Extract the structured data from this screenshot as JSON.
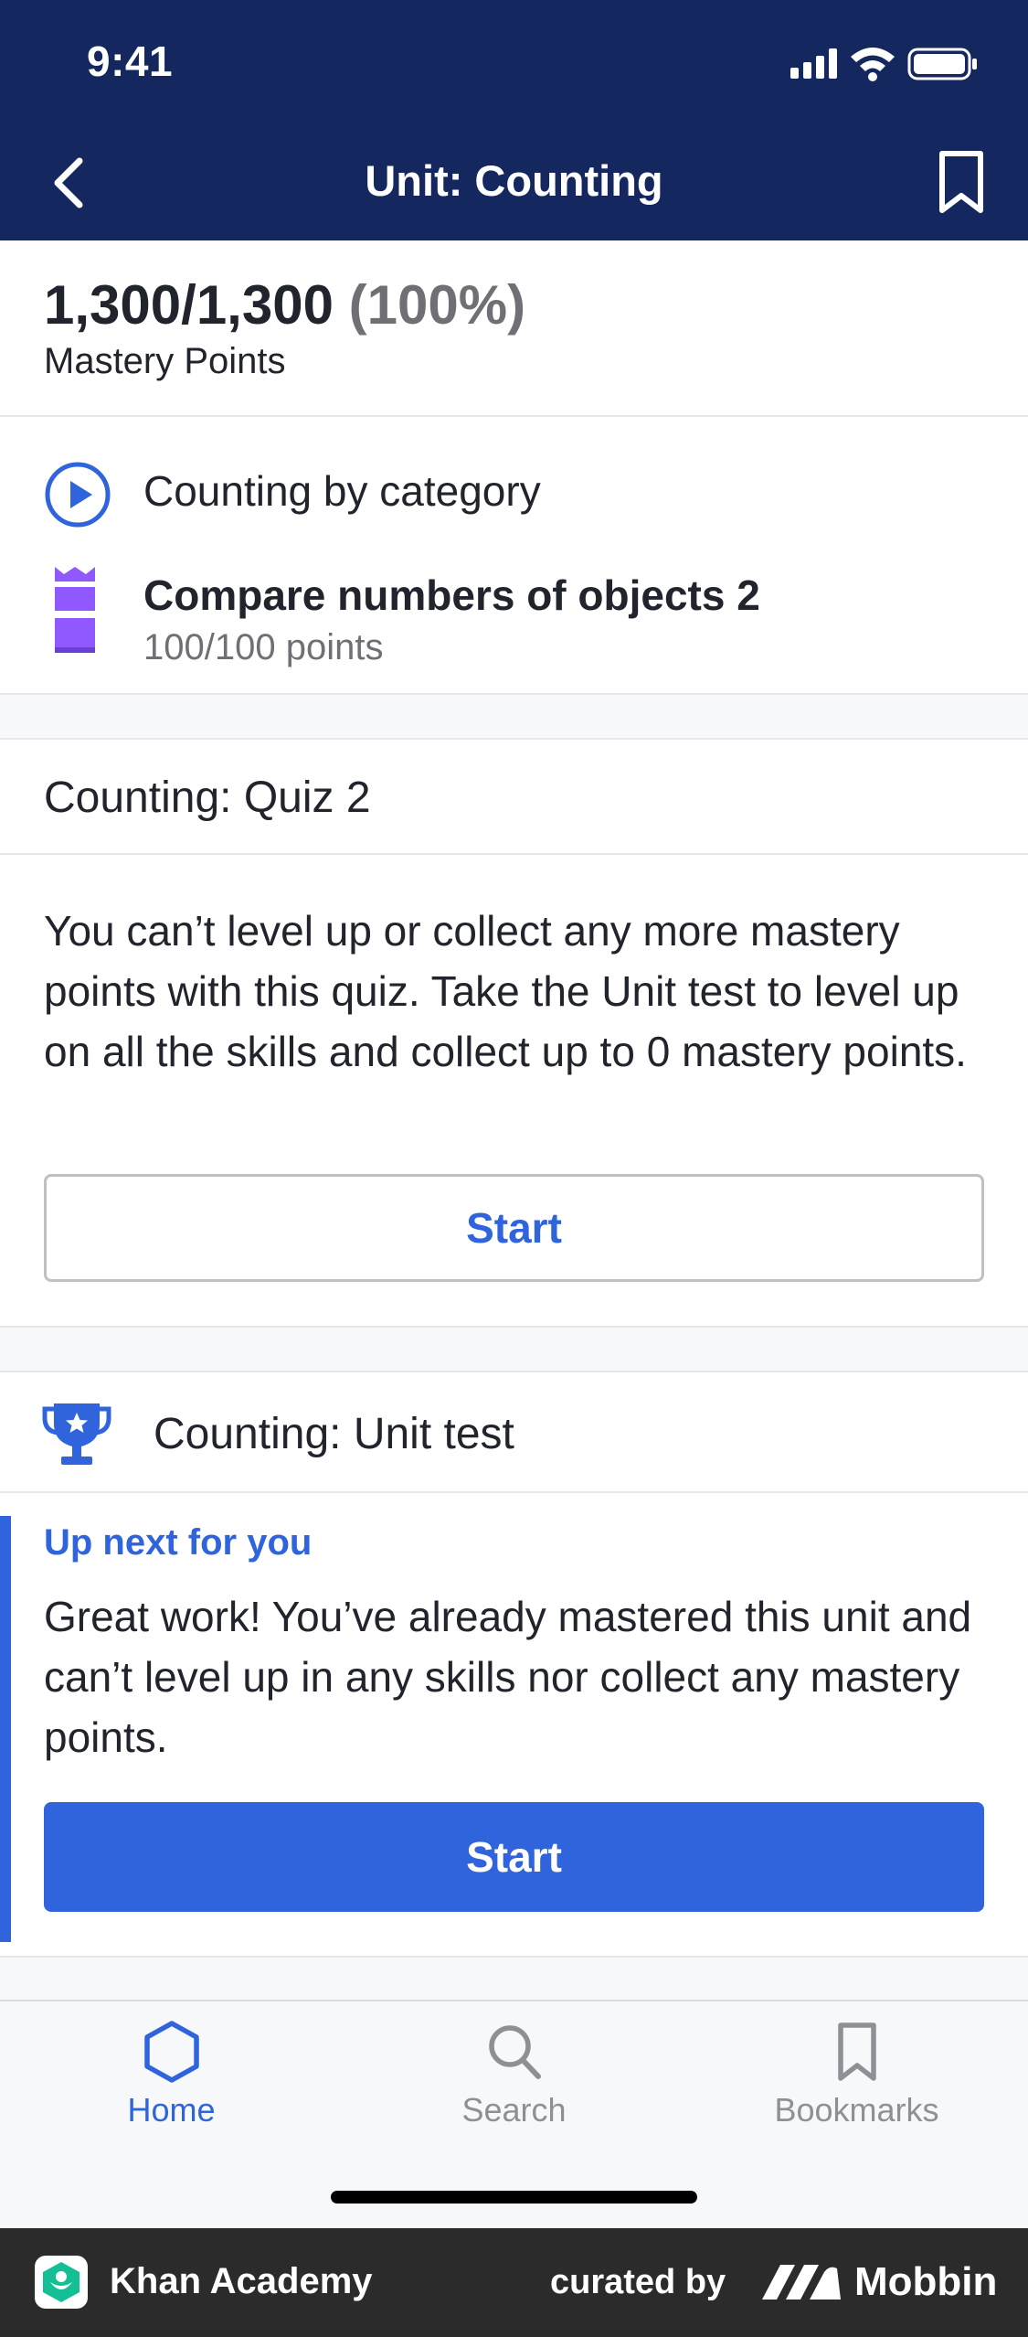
{
  "status_bar": {
    "time": "9:41"
  },
  "nav": {
    "title": "Unit: Counting"
  },
  "mastery": {
    "value": "1,300/1,300",
    "percent": "(100%)",
    "label": "Mastery Points"
  },
  "skills": {
    "video": {
      "title": "Counting by category"
    },
    "exercise": {
      "title": "Compare numbers of objects 2",
      "points": "100/100 points"
    }
  },
  "quiz": {
    "title": "Counting: Quiz 2",
    "message": "You can’t level up or collect any more mastery points with this quiz. Take the Unit test to level up on all the skills and collect up to 0 mastery points.",
    "start_label": "Start"
  },
  "unit_test": {
    "title": "Counting: Unit test",
    "up_next_label": "Up next for you",
    "message": "Great work! You’ve already mastered this unit and can’t level up in any skills nor collect any mastery points.",
    "start_label": "Start"
  },
  "tabs": [
    {
      "label": "Home",
      "icon": "home-hexagon-icon",
      "active": true
    },
    {
      "label": "Search",
      "icon": "search-icon",
      "active": false
    },
    {
      "label": "Bookmarks",
      "icon": "bookmark-icon",
      "active": false
    }
  ],
  "footer": {
    "app_name": "Khan Academy",
    "curated_by": "curated by",
    "brand": "Mobbin"
  },
  "colors": {
    "header": "#14275e",
    "accent": "#2f64dc",
    "mastery_purple": "#9059ff",
    "text": "#21242c",
    "muted": "#6f7075"
  }
}
